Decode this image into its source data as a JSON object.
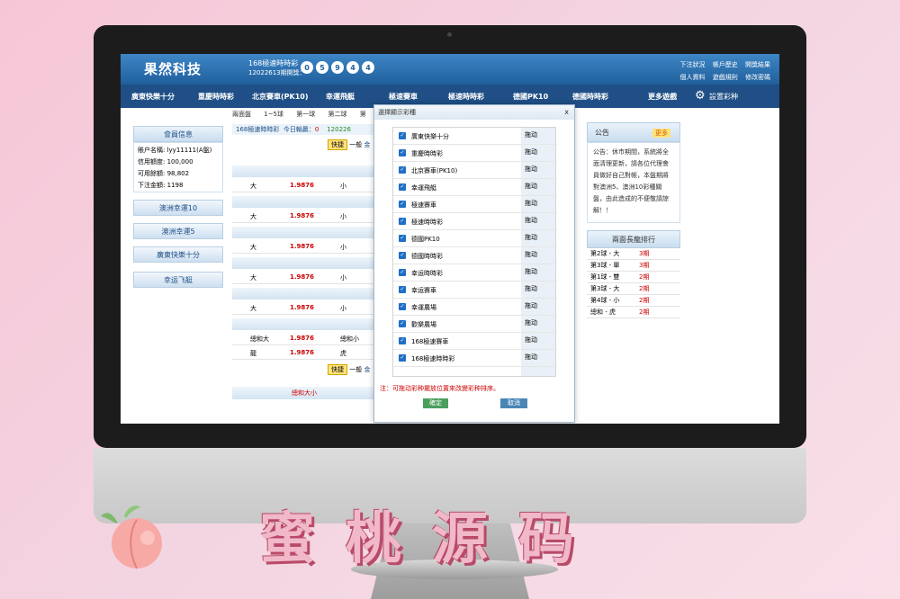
{
  "header": {
    "logo": "果然科技",
    "lottery_title": "168極速時時彩",
    "issue": "12022613期開獎：",
    "balls": [
      "0",
      "5",
      "9",
      "4",
      "4"
    ],
    "links_row1": [
      "下注狀況",
      "帳戶歷史",
      "開獎結果"
    ],
    "links_row2": [
      "個人資料",
      "遊戲規則",
      "修改密碼"
    ]
  },
  "nav": {
    "items": [
      "廣東快樂十分",
      "重慶時時彩",
      "北京賽車(PK10)",
      "幸運飛艇",
      "極速賽車",
      "極速時時彩",
      "德國PK10",
      "德國時時彩",
      "更多遊戲"
    ],
    "settings": "設置彩种"
  },
  "member": {
    "title": "會員信息",
    "rows": [
      {
        "k": "賬户名稱:",
        "v": "lyy11111(A盤)"
      },
      {
        "k": "信用額度:",
        "v": "100,000"
      },
      {
        "k": "可用餘額:",
        "v": "98,802"
      },
      {
        "k": "下注金額:",
        "v": "1198"
      }
    ],
    "buttons": [
      "澳洲幸運10",
      "澳洲幸運5",
      "廣東快樂十分",
      "幸运飞艇"
    ]
  },
  "center": {
    "tabs": [
      "兩面盤",
      "1~5球",
      "第一球",
      "第二球",
      "第"
    ],
    "status_title": "168極速時時彩",
    "status_win_label": "今日輸贏：",
    "status_win": "0",
    "status_issue": "120226",
    "quick_label": "快捷",
    "normal_label": "一般",
    "gold_label": "金",
    "rows": [
      {
        "a": "大",
        "b": "1.9876",
        "c": "小"
      },
      {
        "a": "大",
        "b": "1.9876",
        "c": "小"
      },
      {
        "a": "大",
        "b": "1.9876",
        "c": "小"
      },
      {
        "a": "大",
        "b": "1.9876",
        "c": "小"
      },
      {
        "a": "大",
        "b": "1.9876",
        "c": "小"
      },
      {
        "a": "總和大",
        "b": "1.9876",
        "c": "總和小"
      },
      {
        "a": "龍",
        "b": "1.9876",
        "c": "虎"
      }
    ],
    "bottom_head": "總和大小"
  },
  "notice": {
    "title": "公告",
    "badge": "更多",
    "text": "公告：休市期間，系統將全面清理更新，請各位代理會員做好自己對帳，本盤期將對澳洲5、澳洲10彩種關盤，由此造成的不便敬請諒解！！"
  },
  "ranking": {
    "title": "兩面長龍排行",
    "rows": [
      {
        "n": "第2球 - 大",
        "v": "3期"
      },
      {
        "n": "第3球 - 單",
        "v": "3期"
      },
      {
        "n": "第1球 - 雙",
        "v": "2期"
      },
      {
        "n": "第3球 - 大",
        "v": "2期"
      },
      {
        "n": "第4球 - 小",
        "v": "2期"
      },
      {
        "n": "總和 - 虎",
        "v": "2期"
      }
    ]
  },
  "dialog": {
    "title": "選擇顯示彩種",
    "close": "x",
    "drag_label": "拖动",
    "items": [
      "廣東快樂十分",
      "重慶時時彩",
      "北京賽車(PK10)",
      "幸運飛艇",
      "極速賽車",
      "極速時時彩",
      "德國PK10",
      "德國時時彩",
      "幸运時時彩",
      "幸运賽車",
      "幸運農場",
      "歡樂農場",
      "168極速賽車",
      "168極速時時彩"
    ],
    "note": "注：可拖动彩种擺放位置來改變彩种排序。",
    "ok": "確定",
    "cancel": "取消"
  },
  "banner": "蜜桃源码",
  "colors": {
    "header_blue": "#1f5f9c",
    "nav_blue": "#1f4f86",
    "odds_red": "#cc0000",
    "accent_pink": "#f0b8c8"
  }
}
